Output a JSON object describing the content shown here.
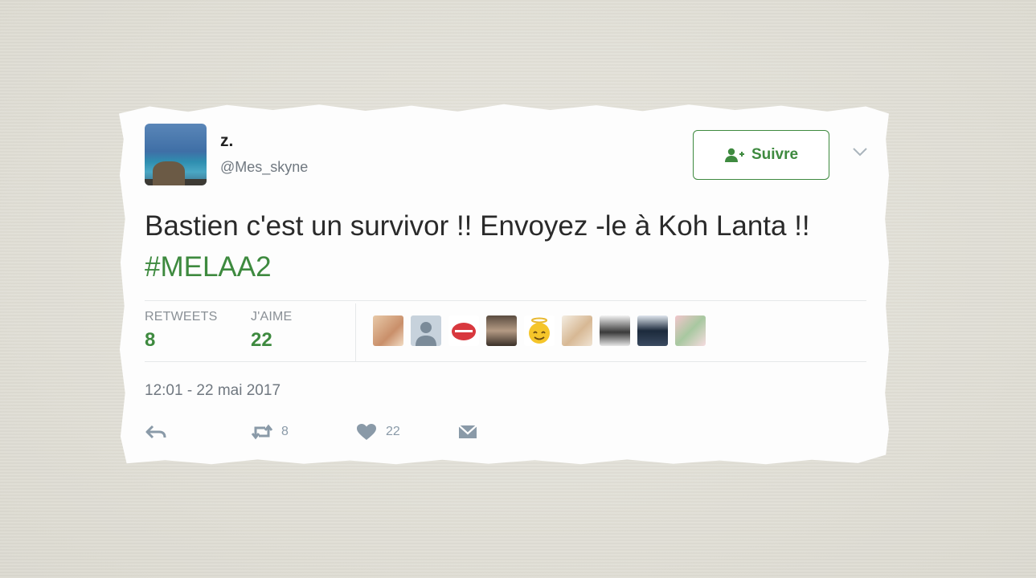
{
  "tweet": {
    "display_name": "z.",
    "handle": "@Mes_skyne",
    "follow_label": "Suivre",
    "text_main": "Bastien c'est un survivor !! Envoyez -le à Koh Lanta !! ",
    "hashtag": "#MELAA2",
    "timestamp": "12:01 - 22 mai 2017"
  },
  "stats": {
    "retweets_label": "RETWEETS",
    "retweets_count": "8",
    "likes_label": "J'AIME",
    "likes_count": "22"
  },
  "actions": {
    "reply_icon": "reply-icon",
    "retweet_icon": "retweet-icon",
    "retweet_count": "8",
    "like_icon": "heart-icon",
    "like_count": "22",
    "dm_icon": "envelope-icon"
  },
  "colors": {
    "accent": "#3e8a3f",
    "text": "#2a2a2a",
    "muted": "#707880",
    "background": "#e2e0d8"
  }
}
